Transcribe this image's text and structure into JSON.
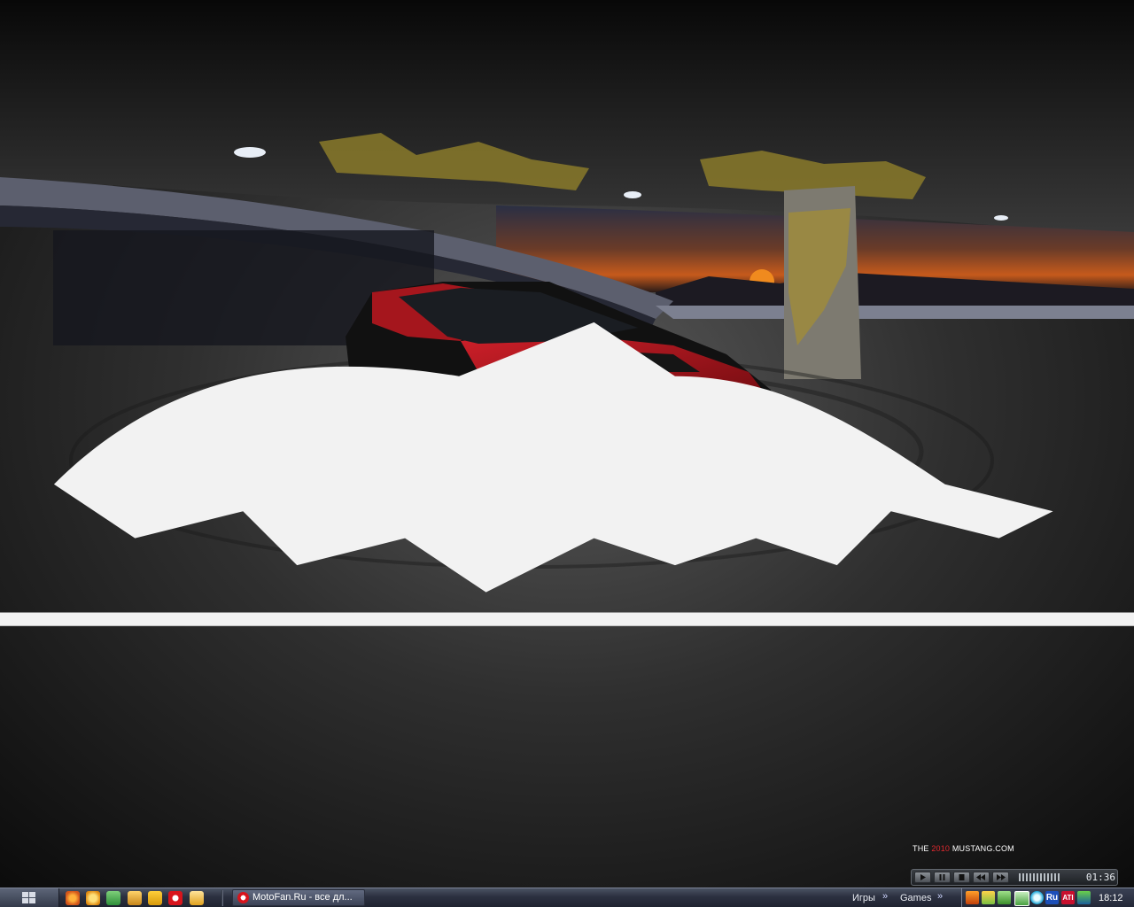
{
  "wallpaper": {
    "brand_prefix": "THE ",
    "brand_year": "2010",
    "brand_suffix": " MUSTANG.COM",
    "accent_red": "#e0282e"
  },
  "player": {
    "time": "01:36",
    "buttons": [
      "play-icon",
      "pause-icon",
      "stop-icon",
      "previous-icon",
      "next-icon"
    ]
  },
  "taskbar": {
    "quick_launch": [
      "firefox-icon",
      "avast-icon",
      "tool-icon",
      "home-icon",
      "butterfly-icon",
      "opera-icon",
      "folder-icon"
    ],
    "task_label": "MotoFan.Ru - все дл...",
    "toolbar_1": "Игры",
    "toolbar_2": "Games",
    "tray_icons": [
      "media-icon",
      "network-icon",
      "tool-icon",
      "icq-icon",
      "skype-icon",
      "language-icon",
      "ati-icon",
      "3d-icon"
    ],
    "language": "Ru",
    "ati": "ATI",
    "clock": "18:12"
  }
}
